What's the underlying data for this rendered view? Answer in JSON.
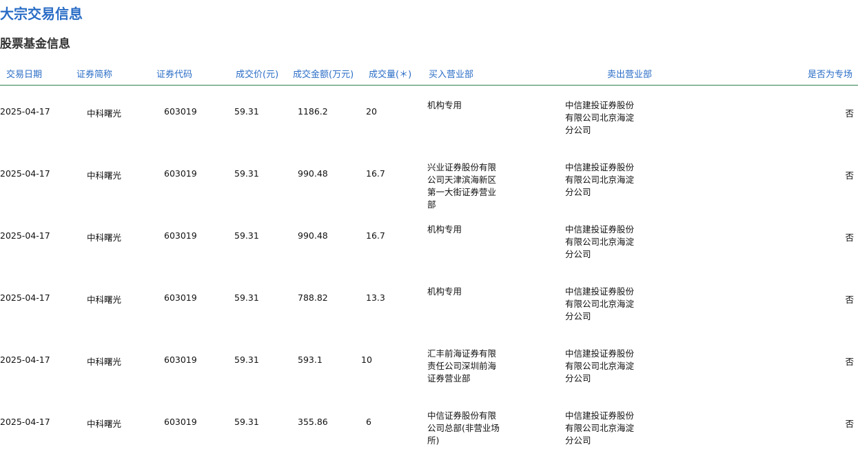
{
  "page": {
    "title": "大宗交易信息",
    "section_title": "股票基金信息"
  },
  "table": {
    "headers": [
      "交易日期",
      "证券简称",
      "证券代码",
      "成交价(元)",
      "成交金额(万元)",
      "成交量(＊)",
      "买入营业部",
      "卖出营业部",
      "是否为专场"
    ],
    "rows": [
      {
        "date": "2025-04-17",
        "name": "中科曙光",
        "code": "603019",
        "price": "59.31",
        "amount": "1186.2",
        "volume": "20",
        "buyer": "机构专用",
        "seller": "中信建投证券股份有限公司北京海淀分公司",
        "special": "否"
      },
      {
        "date": "2025-04-17",
        "name": "中科曙光",
        "code": "603019",
        "price": "59.31",
        "amount": "990.48",
        "volume": "16.7",
        "buyer": "兴业证券股份有限公司天津滨海新区第一大街证券营业部",
        "seller": "中信建投证券股份有限公司北京海淀分公司",
        "special": "否"
      },
      {
        "date": "2025-04-17",
        "name": "中科曙光",
        "code": "603019",
        "price": "59.31",
        "amount": "990.48",
        "volume": "16.7",
        "buyer": "机构专用",
        "seller": "中信建投证券股份有限公司北京海淀分公司",
        "special": "否"
      },
      {
        "date": "2025-04-17",
        "name": "中科曙光",
        "code": "603019",
        "price": "59.31",
        "amount": "788.82",
        "volume": "13.3",
        "buyer": "机构专用",
        "seller": "中信建投证券股份有限公司北京海淀分公司",
        "special": "否"
      },
      {
        "date": "2025-04-17",
        "name": "中科曙光",
        "code": "603019",
        "price": "59.31",
        "amount": "593.1",
        "volume": "10",
        "buyer": "汇丰前海证券有限责任公司深圳前海证券营业部",
        "seller": "中信建投证券股份有限公司北京海淀分公司",
        "special": "否"
      },
      {
        "date": "2025-04-17",
        "name": "中科曙光",
        "code": "603019",
        "price": "59.31",
        "amount": "355.86",
        "volume": "6",
        "buyer": "中信证券股份有限公司总部(非营业场所)",
        "seller": "中信建投证券股份有限公司北京海淀分公司",
        "special": "否"
      }
    ]
  }
}
